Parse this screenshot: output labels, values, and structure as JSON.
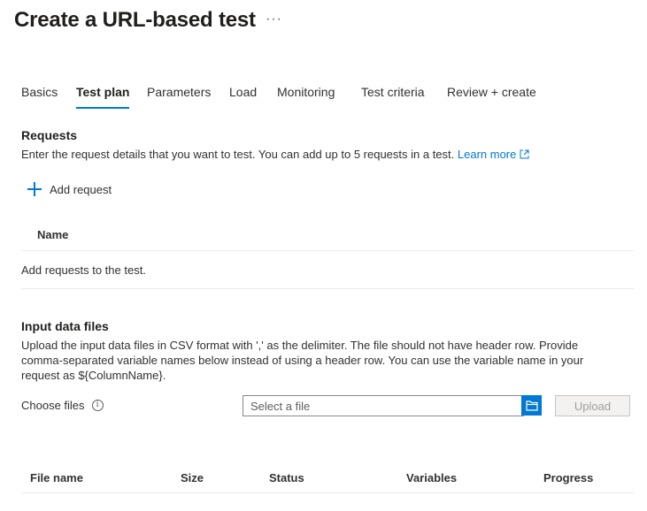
{
  "header": {
    "title": "Create a URL-based test",
    "more": "···"
  },
  "tabs": [
    "Basics",
    "Test plan",
    "Parameters",
    "Load",
    "Monitoring",
    "Test criteria",
    "Review + create"
  ],
  "active_tab": "Test plan",
  "requests": {
    "title": "Requests",
    "description": "Enter the request details that you want to test. You can add up to 5 requests in a test.",
    "learn_more": "Learn more",
    "add_request": "Add request",
    "column_name": "Name",
    "empty_text": "Add requests to the test."
  },
  "input_files": {
    "title": "Input data files",
    "desc_line1": "Upload the input data files in CSV format with ',' as the delimiter. The file should not have header row. Provide",
    "desc_line2": "comma-separated variable names below instead of using a header row. You can use the variable name in your",
    "desc_line3": "request as ${ColumnName}.",
    "choose_label": "Choose files",
    "file_placeholder": "Select a file",
    "upload_label": "Upload",
    "columns": {
      "file_name": "File name",
      "size": "Size",
      "status": "Status",
      "variables": "Variables",
      "progress": "Progress"
    }
  },
  "icons": {
    "info": "info-icon",
    "folder": "folder-icon",
    "add": "plus-icon",
    "external": "external-link-icon",
    "more": "more-icon"
  },
  "colors": {
    "accent": "#0078d4",
    "disabled_bg": "#f3f2f1",
    "divider": "#edebe9"
  }
}
